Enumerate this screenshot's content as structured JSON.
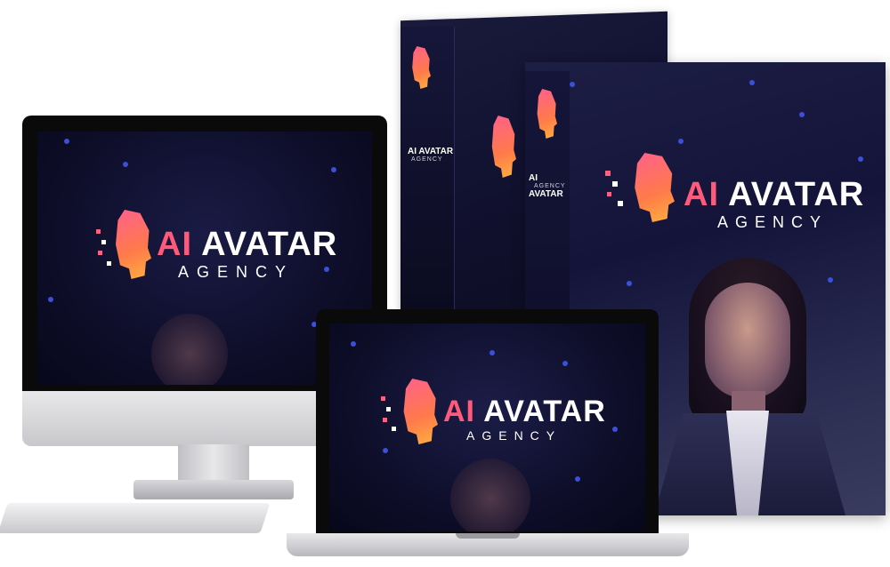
{
  "brand": {
    "title_prefix": "AI",
    "title_main": "AVATAR",
    "subtitle": "AGENCY",
    "accent_color": "#ff5a7a",
    "text_color": "#ffffff"
  },
  "devices": [
    "box-back",
    "box-front",
    "desktop-monitor",
    "laptop",
    "keyboard"
  ],
  "icons": [
    "pixel-head-logo-icon"
  ]
}
